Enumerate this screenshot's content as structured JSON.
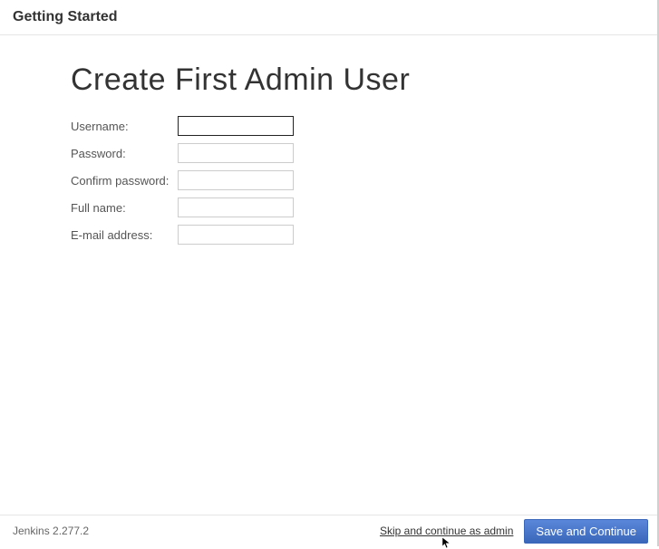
{
  "header": {
    "title": "Getting Started"
  },
  "main": {
    "title": "Create First Admin User",
    "fields": {
      "username": {
        "label": "Username:",
        "value": ""
      },
      "password": {
        "label": "Password:",
        "value": ""
      },
      "confirm_password": {
        "label": "Confirm password:",
        "value": ""
      },
      "full_name": {
        "label": "Full name:",
        "value": ""
      },
      "email": {
        "label": "E-mail address:",
        "value": ""
      }
    }
  },
  "footer": {
    "version": "Jenkins 2.277.2",
    "skip_label": "Skip and continue as admin",
    "save_label": "Save and Continue"
  }
}
